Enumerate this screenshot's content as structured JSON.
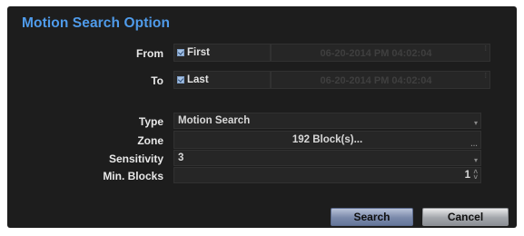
{
  "dialog": {
    "title": "Motion Search Option"
  },
  "from": {
    "label": "From",
    "option_label": "First",
    "datetime": "06-20-2014  PM 04:02:04"
  },
  "to": {
    "label": "To",
    "option_label": "Last",
    "datetime": "06-20-2014  PM 04:02:04"
  },
  "type": {
    "label": "Type",
    "value": "Motion Search"
  },
  "zone": {
    "label": "Zone",
    "value": "192 Block(s)..."
  },
  "sensitivity": {
    "label": "Sensitivity",
    "value": "3"
  },
  "min_blocks": {
    "label": "Min. Blocks",
    "value": "1"
  },
  "buttons": {
    "search": "Search",
    "cancel": "Cancel"
  },
  "colors": {
    "title": "#4f9bea",
    "background": "#1d1d1d",
    "field": "#262626"
  }
}
